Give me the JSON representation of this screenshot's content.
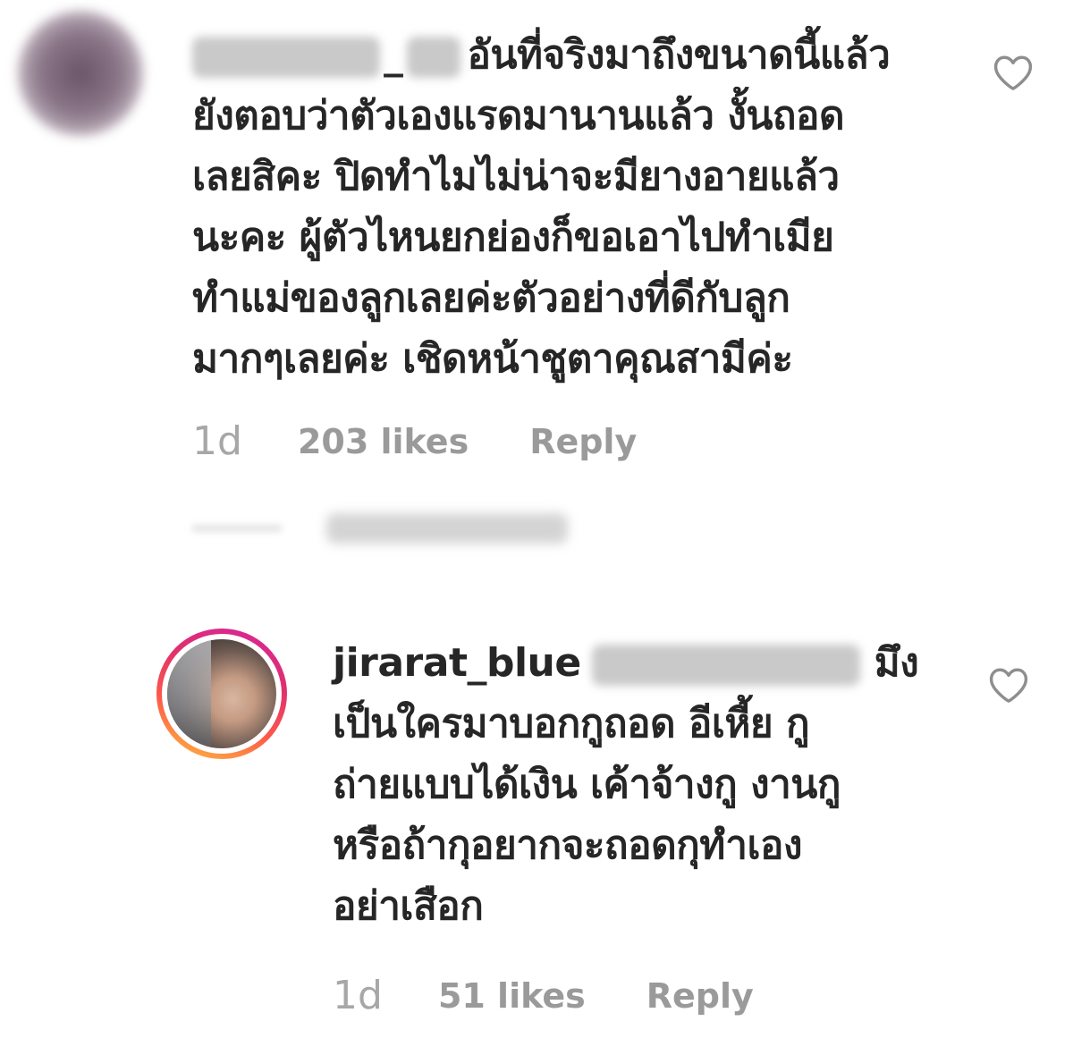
{
  "comments": [
    {
      "username_visible": "_",
      "lines": [
        "อันที่จริงมาถึงขนาดนี้แล้ว",
        "ยังตอบว่าตัวเองแรดมานานแล้ว งั้นถอด",
        "เลยสิคะ ปิดทำไมไม่น่าจะมียางอายแล้ว",
        "นะคะ ผู้ตัวไหนยกย่องก็ขอเอาไปทำเมีย",
        "ทำแม่ของลูกเลยค่ะตัวอย่างที่ดีกับลูก",
        "มากๆเลยค่ะ เชิดหน้าชูตาคุณสามีค่ะ"
      ],
      "time": "1d",
      "likes": "203 likes",
      "reply": "Reply",
      "like_icon": "heart-outline-icon"
    },
    {
      "username": "jirarat_blue",
      "lines": [
        "มึง",
        "เป็นใครมาบอกกูถอด อีเหี้ย กู",
        "ถ่ายแบบได้เงิน เค้าจ้างกู งานกู",
        "หรือถ้ากุอยากจะถอดกุทำเอง",
        "อย่าเสือก"
      ],
      "time": "1d",
      "likes": "51 likes",
      "reply": "Reply",
      "like_icon": "heart-outline-icon"
    }
  ],
  "colors": {
    "text": "#262626",
    "meta": "#9a9a9a",
    "story_ring_start": "#d6249f",
    "story_ring_end": "#fdbf3f"
  }
}
